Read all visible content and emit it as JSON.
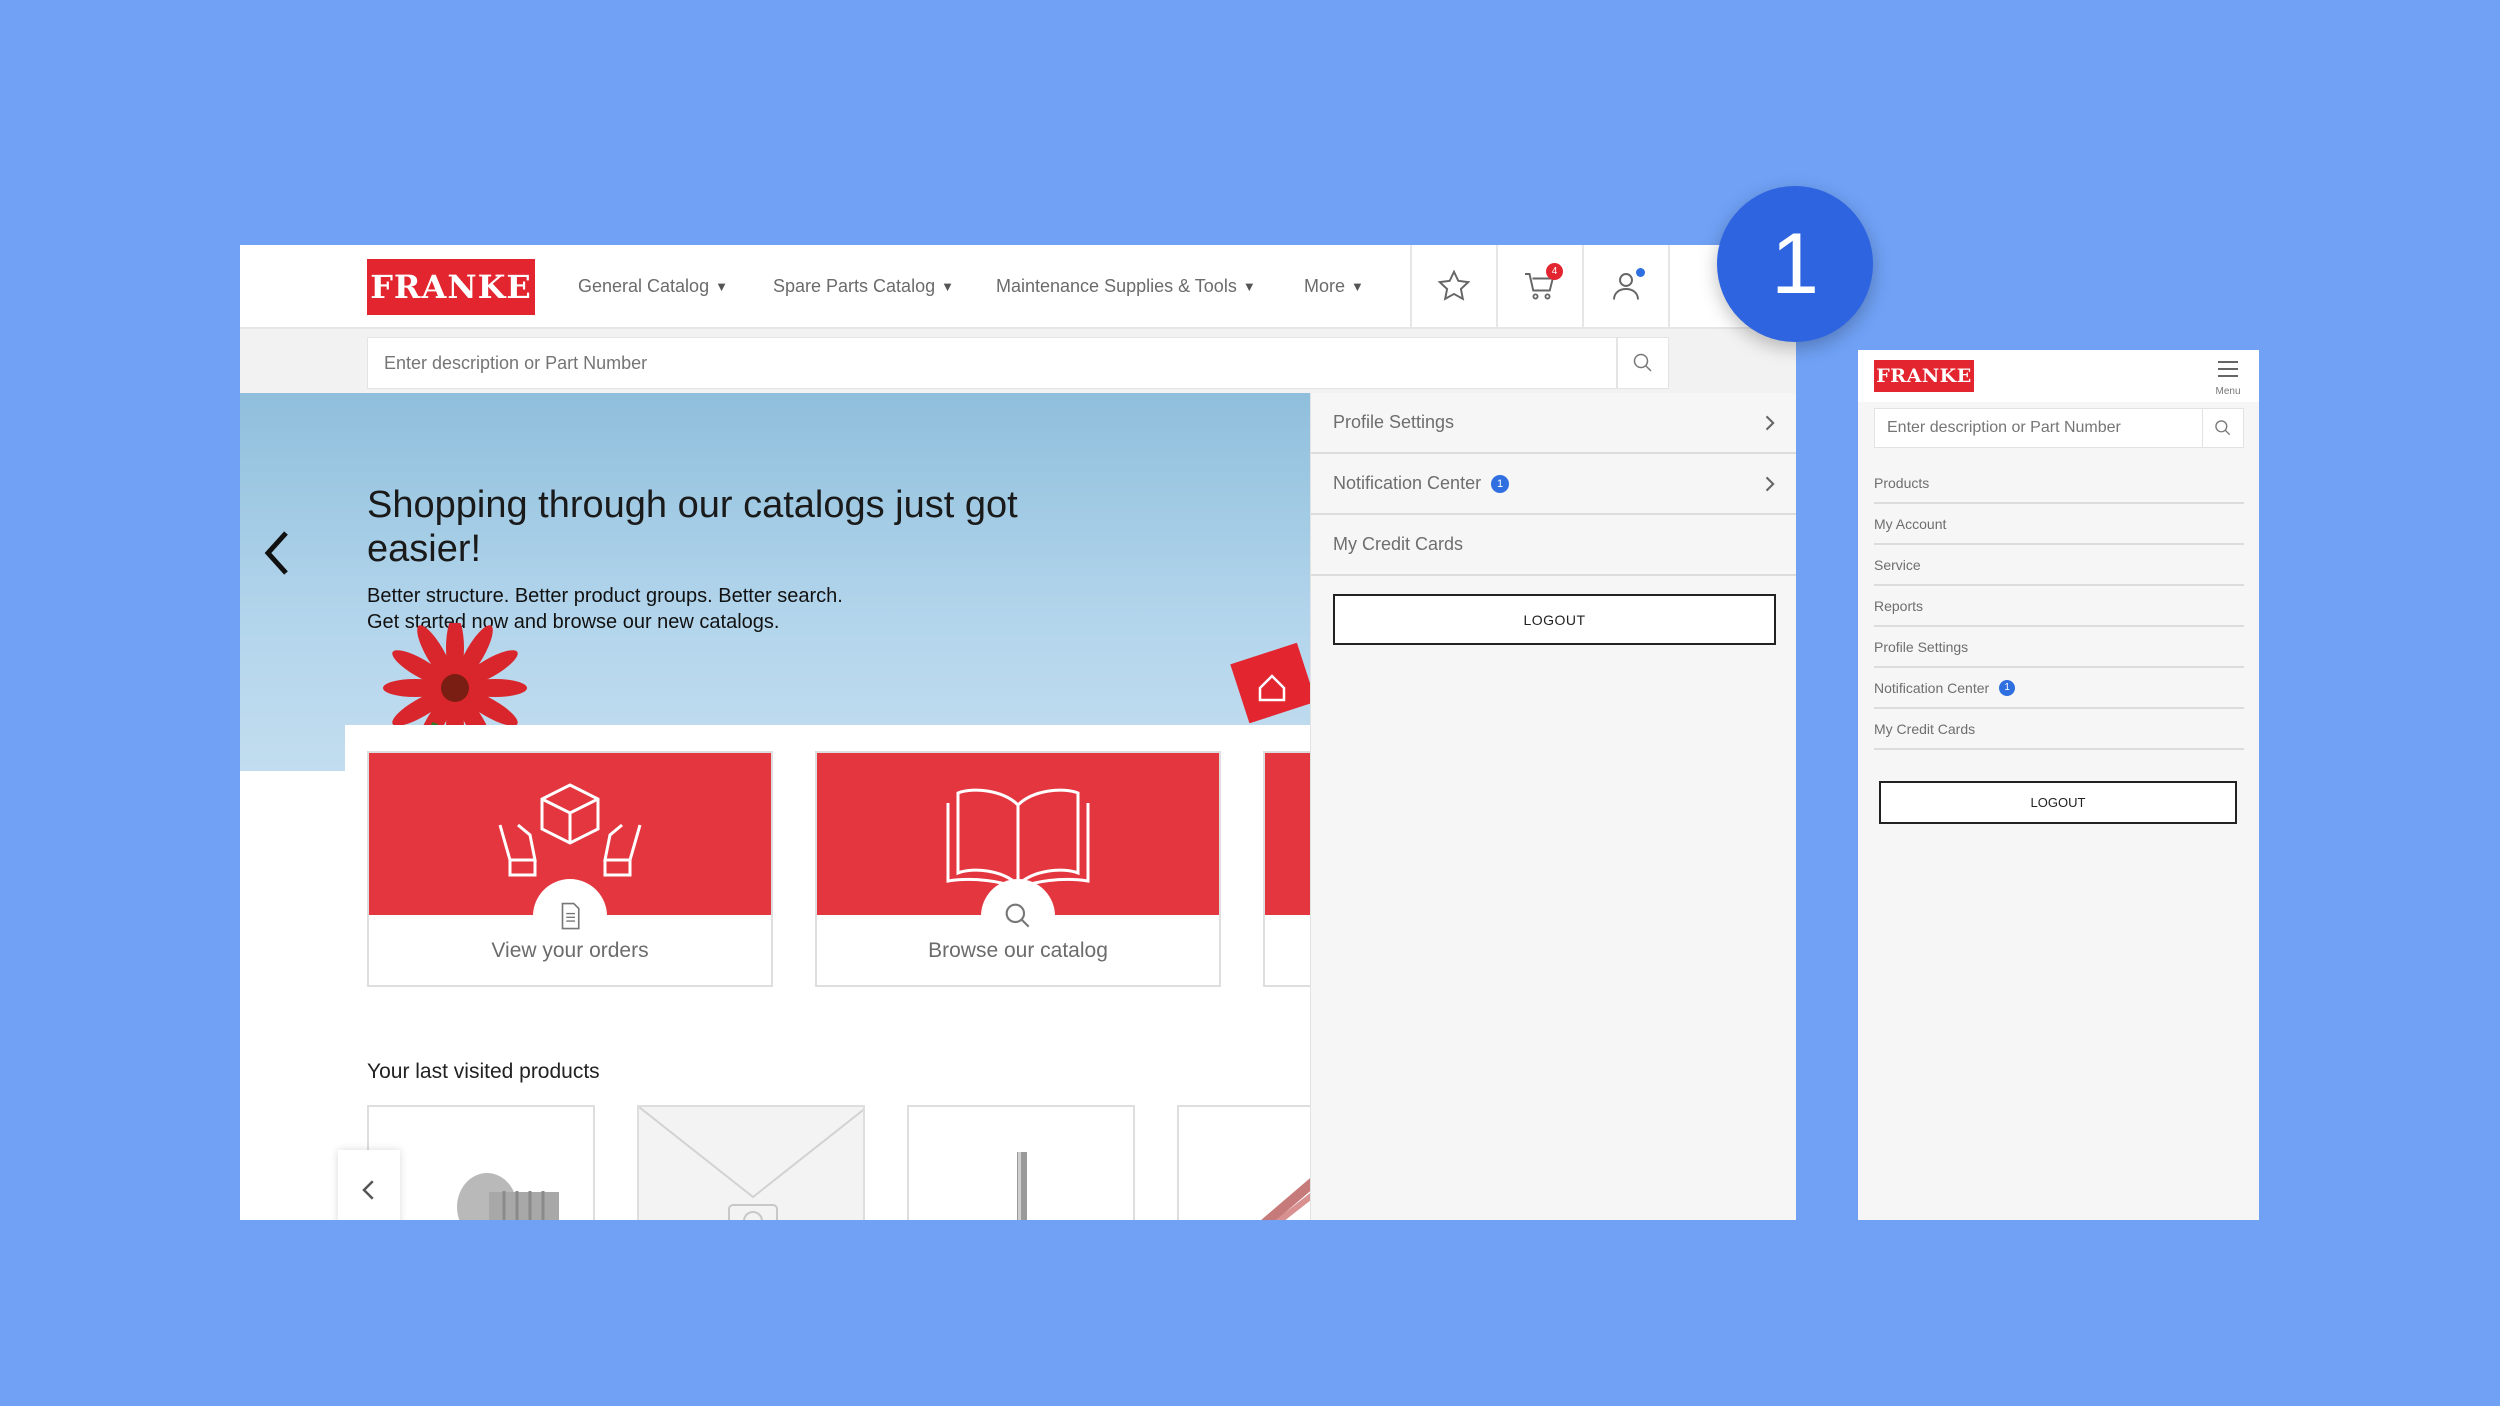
{
  "desktop": {
    "logo_text": "FRANKE",
    "nav": [
      {
        "label": "General Catalog"
      },
      {
        "label": "Spare Parts Catalog"
      },
      {
        "label": "Maintenance Supplies & Tools"
      },
      {
        "label": "More"
      }
    ],
    "icons": {
      "favorites": "star-icon",
      "cart": "cart-icon",
      "account": "user-icon"
    },
    "cart_count": "4",
    "search": {
      "placeholder": "Enter description or Part Number"
    },
    "hero": {
      "title": "Shopping through our catalogs just got easier!",
      "subtitle_line1": "Better structure. Better product groups. Better search.",
      "subtitle_line2": "Get started now and browse our new catalogs."
    },
    "cards": [
      {
        "label": "View your orders",
        "icon": "document-icon"
      },
      {
        "label": "Browse our catalog",
        "icon": "search-icon"
      }
    ],
    "recent_title": "Your last visited products",
    "account_menu": {
      "items": [
        {
          "label": "Profile Settings"
        },
        {
          "label": "Notification Center",
          "badge": "1"
        },
        {
          "label": "My Credit Cards"
        }
      ],
      "logout_label": "LOGOUT"
    }
  },
  "step_number": "1",
  "mobile": {
    "logo_text": "FRANKE",
    "menu_label": "Menu",
    "search": {
      "placeholder": "Enter description or Part Number"
    },
    "items": [
      {
        "label": "Products"
      },
      {
        "label": "My Account"
      },
      {
        "label": "Service"
      },
      {
        "label": "Reports"
      },
      {
        "label": "Profile Settings"
      },
      {
        "label": "Notification Center",
        "badge": "1"
      },
      {
        "label": "My Credit Cards"
      }
    ],
    "logout_label": "LOGOUT"
  },
  "colors": {
    "background": "#70a1f5",
    "brand_red": "#e3252f",
    "accent_blue": "#2e64e0"
  }
}
